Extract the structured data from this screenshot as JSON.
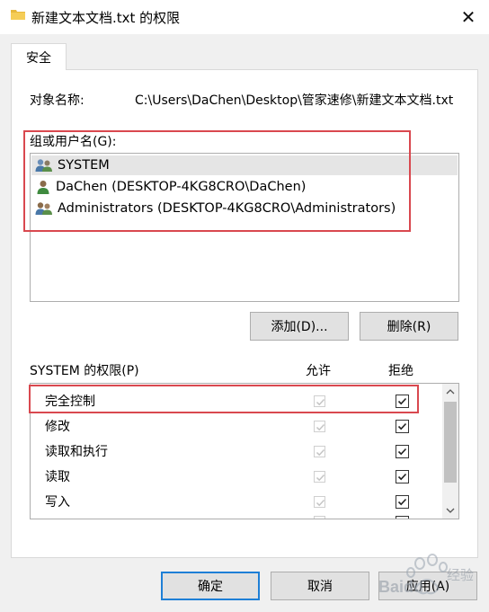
{
  "window": {
    "title": "新建文本文档.txt 的权限",
    "close_glyph": "✕"
  },
  "tab": {
    "label": "安全"
  },
  "object": {
    "label": "对象名称:",
    "value": "C:\\Users\\DaChen\\Desktop\\管家速修\\新建文本文档.txt"
  },
  "groups": {
    "label": "组或用户名(G):",
    "items": [
      {
        "label": "SYSTEM",
        "icon": "group-users-icon",
        "selected": true
      },
      {
        "label": "DaChen (DESKTOP-4KG8CRO\\DaChen)",
        "icon": "user-icon",
        "selected": false
      },
      {
        "label": "Administrators (DESKTOP-4KG8CRO\\Administrators)",
        "icon": "group-users-icon",
        "selected": false
      }
    ]
  },
  "buttons": {
    "add": "添加(D)...",
    "remove": "删除(R)",
    "ok": "确定",
    "cancel": "取消",
    "apply": "应用(A)"
  },
  "permissions": {
    "title": "SYSTEM 的权限(P)",
    "allow_header": "允许",
    "deny_header": "拒绝",
    "rows": [
      {
        "name": "完全控制",
        "allow": true,
        "deny": true
      },
      {
        "name": "修改",
        "allow": true,
        "deny": true
      },
      {
        "name": "读取和执行",
        "allow": true,
        "deny": true
      },
      {
        "name": "读取",
        "allow": true,
        "deny": true
      },
      {
        "name": "写入",
        "allow": true,
        "deny": true
      }
    ]
  },
  "watermark": {
    "brand": "Baidu",
    "text": "经验"
  },
  "colors": {
    "highlight": "#d9484f",
    "selection": "#e5e5e5",
    "default_button_border": "#1e7fd6"
  }
}
